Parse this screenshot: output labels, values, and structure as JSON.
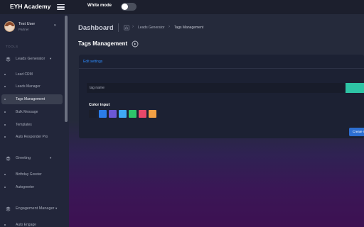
{
  "topbar": {
    "brand": "EYH Academy",
    "mode_label": "White mode"
  },
  "user": {
    "name": "Test User",
    "role": "Partner"
  },
  "sidebar": {
    "section_label": "TOOLS",
    "groups": [
      {
        "label": "Leads Generator",
        "caret": "▾",
        "items": [
          {
            "label": "Lead CRM"
          },
          {
            "label": "Leads Manager"
          },
          {
            "label": "Tags Management",
            "active": true
          },
          {
            "label": "Bulk Message"
          },
          {
            "label": "Templates"
          },
          {
            "label": "Auto Responder Pro"
          }
        ]
      },
      {
        "label": "Greeting",
        "caret": "▾",
        "items": [
          {
            "label": "Birthday Greeter"
          },
          {
            "label": "Autogreeter"
          }
        ]
      },
      {
        "label": "Engagement Manager",
        "caret": "▾",
        "items": [
          {
            "label": "Auto Engage"
          }
        ]
      }
    ]
  },
  "header": {
    "title": "Dashboard",
    "breadcrumb": [
      "Leads Generator",
      "Tags Management"
    ],
    "page_title": "Tags Management"
  },
  "card": {
    "title": "Edit settings",
    "tag_input": {
      "value": "",
      "placeholder": "tag name"
    },
    "color_label": "Color input",
    "swatches": [
      "#1b1e2b",
      "#2b7de9",
      "#6c58d6",
      "#3fa9f5",
      "#2fc36b",
      "#e8486a",
      "#f2a044"
    ],
    "create_button": "Create n"
  },
  "colors": {
    "accent": "#2d8cff",
    "add_button": "#2ec4a5",
    "create_button": "#2d6fd1"
  },
  "icons": {
    "menu": "hamburger-icon",
    "home": "home-icon",
    "page_action": "circle-arrow-icon",
    "group": "layers-icon"
  }
}
